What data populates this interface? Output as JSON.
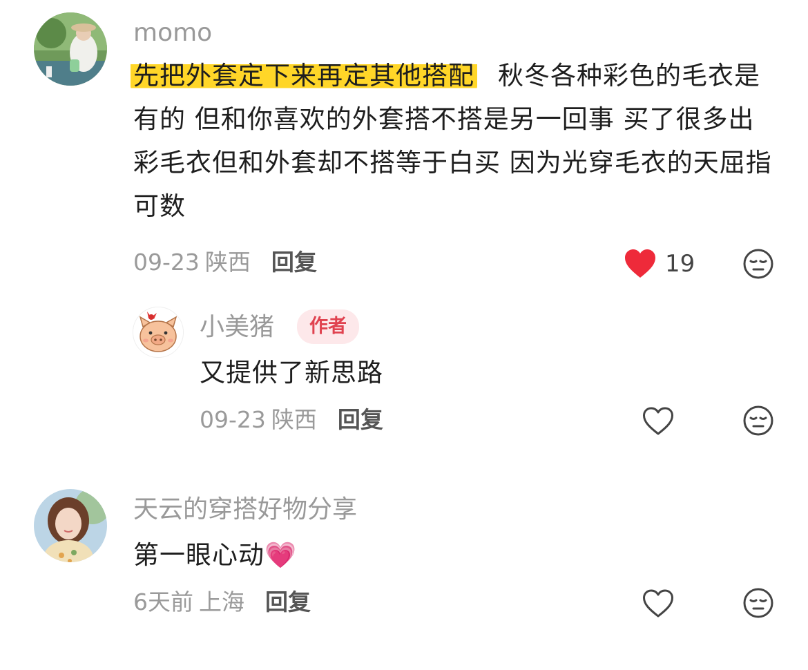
{
  "comments": [
    {
      "username": "momo",
      "text_highlight": "先把外套定下来再定其他搭配",
      "text_rest": "秋冬各种彩色的毛衣是有的 但和你喜欢的外套搭不搭是另一回事 买了很多出彩毛衣但和外套却不搭等于白买 因为光穿毛衣的天屈指可数",
      "date": "09-23",
      "location": "陕西",
      "reply_label": "回复",
      "like_count": "19",
      "liked": true,
      "reply": {
        "username": "小美猪",
        "badge": "作者",
        "text": "又提供了新思路",
        "date": "09-23",
        "location": "陕西",
        "reply_label": "回复"
      }
    },
    {
      "username": "天云的穿搭好物分享",
      "text": "第一眼心动",
      "emoji": "💗",
      "date": "6天前",
      "location": "上海",
      "reply_label": "回复"
    }
  ],
  "colors": {
    "highlight": "#ffd628",
    "like_red": "#ee2a3a",
    "badge_bg": "#fde8ea",
    "badge_text": "#e0424f"
  },
  "icons": [
    "heart-filled-icon",
    "heart-outline-icon",
    "dislike-face-icon"
  ]
}
